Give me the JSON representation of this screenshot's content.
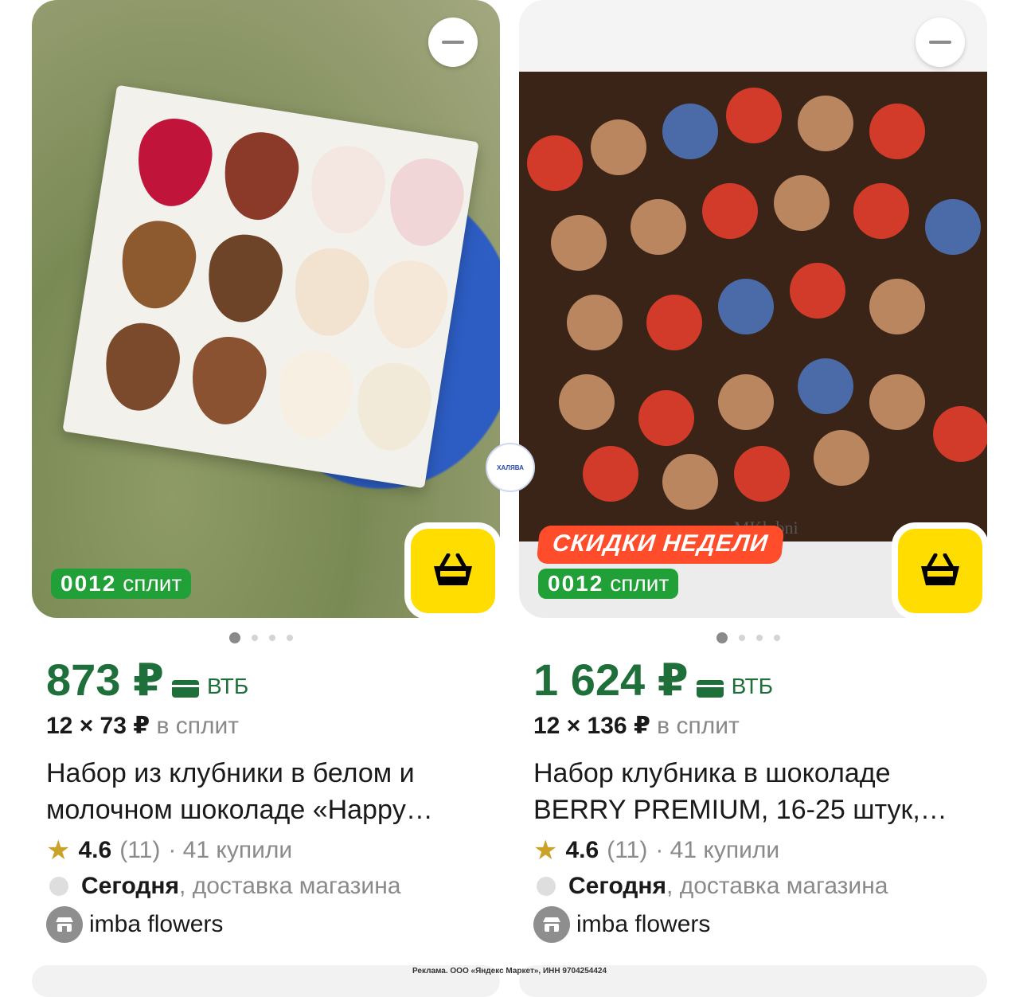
{
  "cards": [
    {
      "badge": {
        "number": "0012",
        "label": "сплит"
      },
      "price": "873 ₽",
      "bank": "ВТБ",
      "split": {
        "amount": "12 × 73 ₽",
        "suffix": "в сплит"
      },
      "title": "Набор из клубники в белом и молочном шоколаде «Happy…",
      "rating": {
        "score": "4.6",
        "count": "(11)",
        "bought": "· 41 купили"
      },
      "delivery": {
        "day": "Сегодня",
        "rest": ", доставка магазина"
      },
      "shop": "imba flowers",
      "dots": {
        "total": 4,
        "active": 0
      }
    },
    {
      "promo": "СКИДКИ НЕДЕЛИ",
      "badge": {
        "number": "0012",
        "label": "сплит"
      },
      "price": "1 624 ₽",
      "bank": "ВТБ",
      "split": {
        "amount": "12 × 136 ₽",
        "suffix": "в сплит"
      },
      "title": "Набор клубника в шоколаде BERRY PREMIUM, 16-25 штук,…",
      "rating": {
        "score": "4.6",
        "count": "(11)",
        "bought": "· 41 купили"
      },
      "delivery": {
        "day": "Сегодня",
        "rest": ", доставка магазина"
      },
      "shop": "imba flowers",
      "photo_watermark": "MKlubni",
      "dots": {
        "total": 4,
        "active": 0
      }
    }
  ],
  "sticker": "ХАЛЯВА",
  "ad_disclaimer": "Реклама. ООО «Яндекс Маркет», ИНН 9704254424",
  "colors": {
    "price_green": "#1f6f3a",
    "split_green": "#21a038",
    "cart_yellow": "#ffdd00",
    "promo_red": "#ff4c2b"
  },
  "icons": {
    "remove": "minus-icon",
    "cart": "basket-icon",
    "rating": "star-icon",
    "shop": "store-icon",
    "bank_card": "bank-card-icon"
  }
}
